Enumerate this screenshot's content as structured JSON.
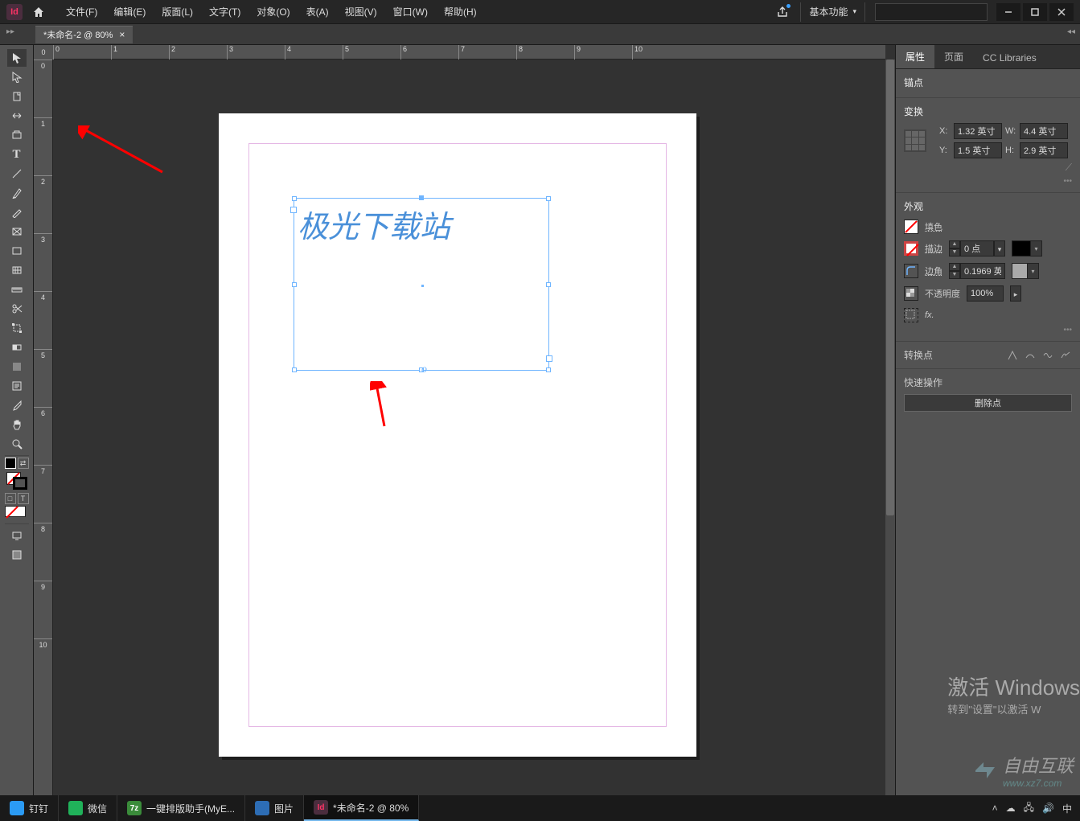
{
  "app": {
    "logo_text": "Id"
  },
  "menu": {
    "file": "文件(F)",
    "edit": "编辑(E)",
    "layout": "版面(L)",
    "text": "文字(T)",
    "object": "对象(O)",
    "table": "表(A)",
    "view": "视图(V)",
    "window": "窗口(W)",
    "help": "帮助(H)"
  },
  "workspace_dropdown": "基本功能",
  "document_tab": {
    "title": "*未命名-2 @ 80%",
    "close": "×"
  },
  "ruler": {
    "corner": "0",
    "h_ticks": [
      "0",
      "1",
      "2",
      "3",
      "4",
      "5",
      "6",
      "7",
      "8",
      "9",
      "10"
    ],
    "v_ticks": [
      "0",
      "1",
      "2",
      "3",
      "4",
      "5",
      "6",
      "7",
      "8",
      "9",
      "10"
    ]
  },
  "canvas_text": "极光下载站",
  "panel_tabs": {
    "properties": "属性",
    "pages": "页面",
    "cc": "CC Libraries"
  },
  "properties": {
    "anchor_title": "锚点",
    "transform_title": "变换",
    "x_label": "X:",
    "x_value": "1.32 英寸",
    "y_label": "Y:",
    "y_value": "1.5 英寸",
    "w_label": "W:",
    "w_value": "4.4 英寸",
    "h_label": "H:",
    "h_value": "2.9 英寸",
    "more": "•••",
    "appearance_title": "外观",
    "fill_label": "填色",
    "stroke_label": "描边",
    "stroke_value": "0 点",
    "corner_label": "边角",
    "corner_value": "0.1969 英",
    "opacity_label": "不透明度",
    "opacity_value": "100%",
    "fx_label": "fx.",
    "transform_point_title": "转换点",
    "quick_ops_title": "快速操作",
    "delete_point_btn": "删除点"
  },
  "watermark": {
    "line1": "激活 Windows",
    "line2": "转到\"设置\"以激活 W",
    "brand": "自由互联",
    "url": "www.xz7.com"
  },
  "taskbar": {
    "items": [
      {
        "icon_bg": "#2b9bf4",
        "icon_text": "",
        "label": "钉钉"
      },
      {
        "icon_bg": "#20b25a",
        "icon_text": "",
        "label": "微信"
      },
      {
        "icon_bg": "#3a8b3a",
        "icon_text": "7z",
        "label": "一键排版助手(MyE..."
      },
      {
        "icon_bg": "#2d6db5",
        "icon_text": "",
        "label": "图片"
      },
      {
        "icon_bg": "#4b2d3e",
        "icon_text": "Id",
        "label": "*未命名-2 @ 80%"
      }
    ],
    "ime": "中"
  },
  "toolbox_mode_labels": {
    "fill": "□",
    "text": "T"
  }
}
